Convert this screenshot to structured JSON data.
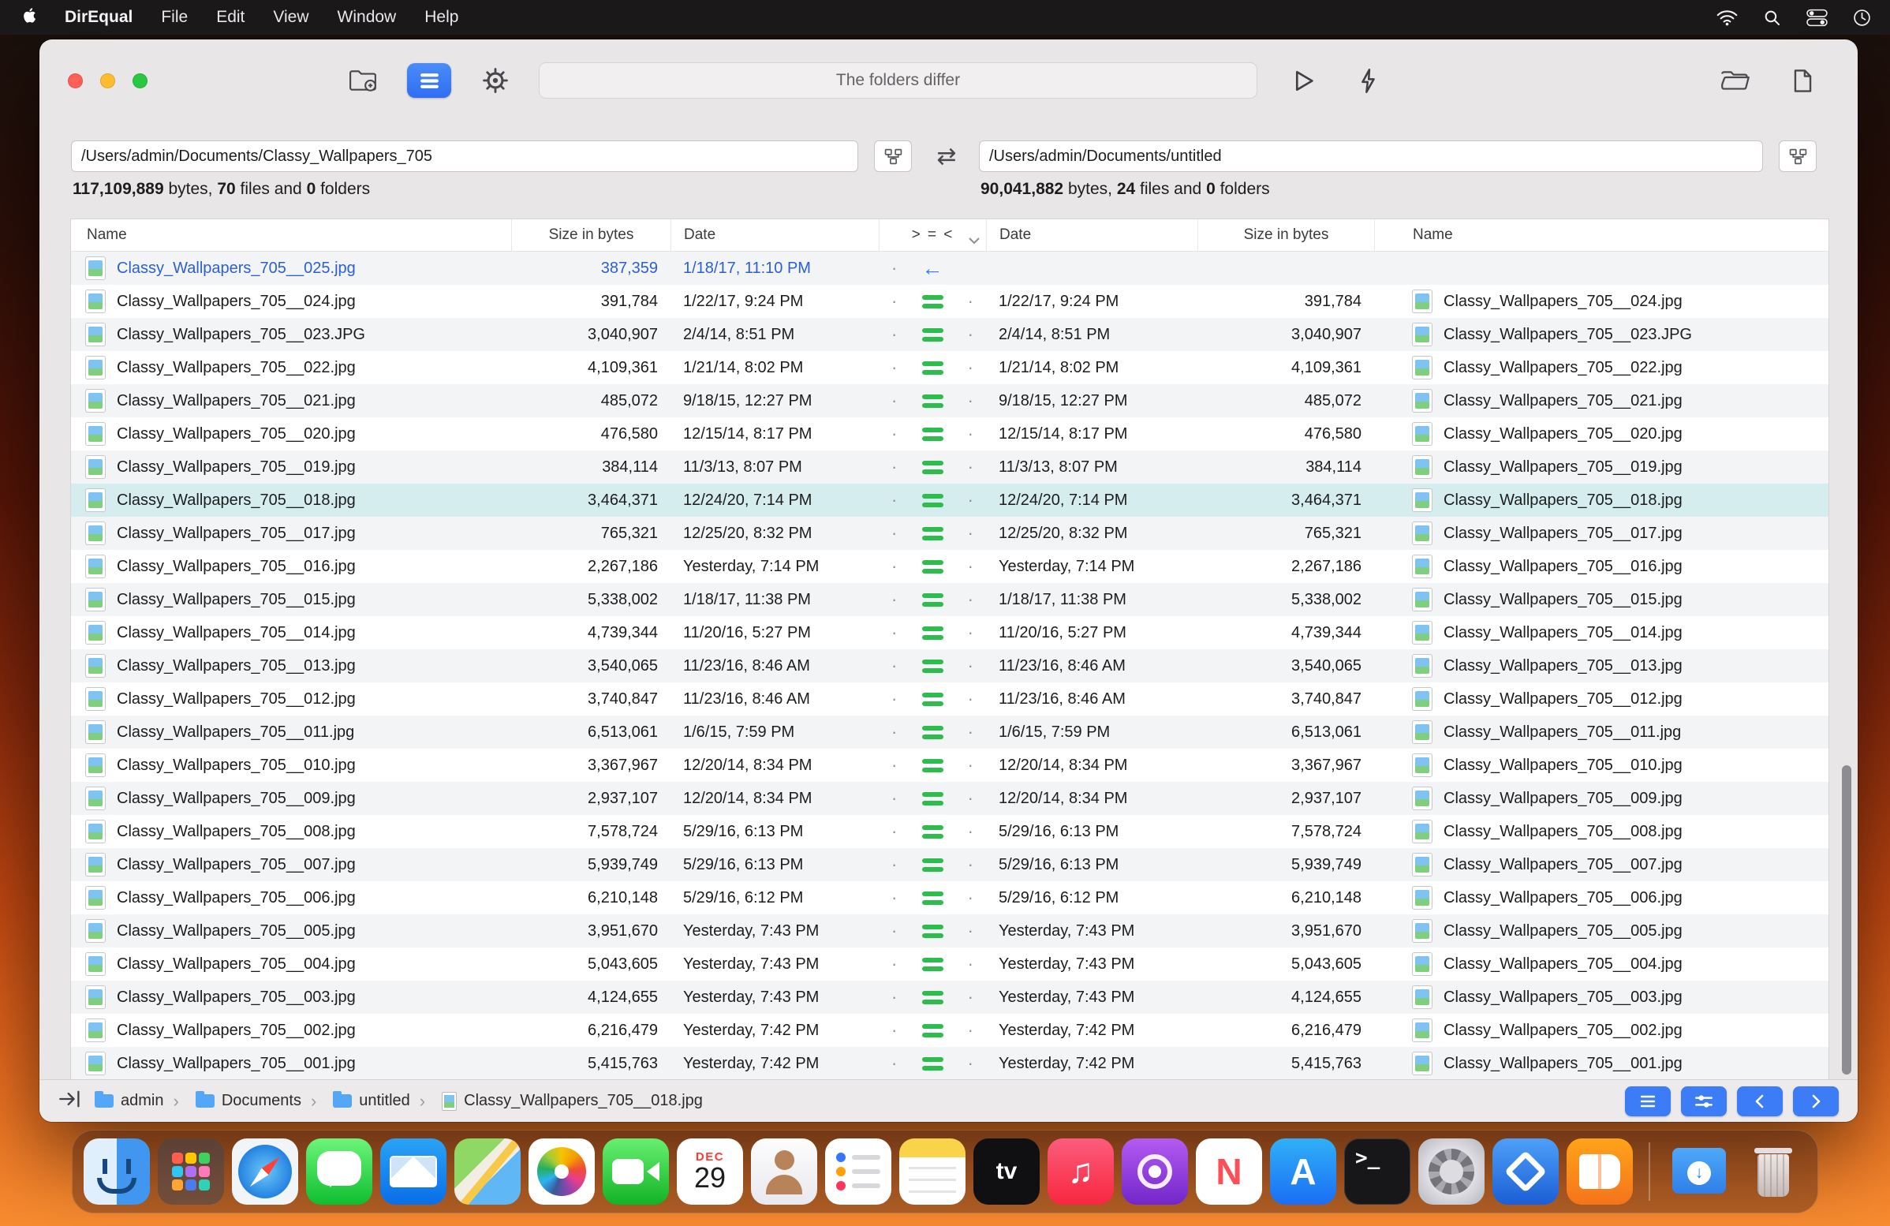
{
  "menu_bar": {
    "app_name": "DirEqual",
    "menus": [
      "File",
      "Edit",
      "View",
      "Window",
      "Help"
    ]
  },
  "toolbar": {
    "status_text": "The folders differ"
  },
  "panes": {
    "left": {
      "path": "/Users/admin/Documents/Classy_Wallpapers_705",
      "bytes": "117,109,889",
      "files": "70",
      "folders": "0"
    },
    "right": {
      "path": "/Users/admin/Documents/untitled",
      "bytes": "90,041,882",
      "files": "24",
      "folders": "0"
    },
    "bytes_word": " bytes, ",
    "files_word": " files and ",
    "folders_word": " folders"
  },
  "icons": {
    "swap": "⇄",
    "dot": "·",
    "left_arrow": "←"
  },
  "table": {
    "headers": {
      "name_left": "Name",
      "size_left": "Size in bytes",
      "date_left": "Date",
      "compare": "> = <",
      "date_right": "Date",
      "size_right": "Size in bytes",
      "name_right": "Name"
    },
    "rows": [
      {
        "name": "Classy_Wallpapers_705__025.jpg",
        "size": "387,359",
        "date": "1/18/17, 11:10 PM",
        "status": "left_only",
        "selected": false
      },
      {
        "name": "Classy_Wallpapers_705__024.jpg",
        "size": "391,784",
        "date": "1/22/17, 9:24 PM",
        "status": "equal",
        "selected": false
      },
      {
        "name": "Classy_Wallpapers_705__023.JPG",
        "size": "3,040,907",
        "date": "2/4/14, 8:51 PM",
        "status": "equal",
        "selected": false
      },
      {
        "name": "Classy_Wallpapers_705__022.jpg",
        "size": "4,109,361",
        "date": "1/21/14, 8:02 PM",
        "status": "equal",
        "selected": false
      },
      {
        "name": "Classy_Wallpapers_705__021.jpg",
        "size": "485,072",
        "date": "9/18/15, 12:27 PM",
        "status": "equal",
        "selected": false
      },
      {
        "name": "Classy_Wallpapers_705__020.jpg",
        "size": "476,580",
        "date": "12/15/14, 8:17 PM",
        "status": "equal",
        "selected": false
      },
      {
        "name": "Classy_Wallpapers_705__019.jpg",
        "size": "384,114",
        "date": "11/3/13, 8:07 PM",
        "status": "equal",
        "selected": false
      },
      {
        "name": "Classy_Wallpapers_705__018.jpg",
        "size": "3,464,371",
        "date": "12/24/20, 7:14 PM",
        "status": "equal",
        "selected": true
      },
      {
        "name": "Classy_Wallpapers_705__017.jpg",
        "size": "765,321",
        "date": "12/25/20, 8:32 PM",
        "status": "equal",
        "selected": false
      },
      {
        "name": "Classy_Wallpapers_705__016.jpg",
        "size": "2,267,186",
        "date": "Yesterday, 7:14 PM",
        "status": "equal",
        "selected": false
      },
      {
        "name": "Classy_Wallpapers_705__015.jpg",
        "size": "5,338,002",
        "date": "1/18/17, 11:38 PM",
        "status": "equal",
        "selected": false
      },
      {
        "name": "Classy_Wallpapers_705__014.jpg",
        "size": "4,739,344",
        "date": "11/20/16, 5:27 PM",
        "status": "equal",
        "selected": false
      },
      {
        "name": "Classy_Wallpapers_705__013.jpg",
        "size": "3,540,065",
        "date": "11/23/16, 8:46 AM",
        "status": "equal",
        "selected": false
      },
      {
        "name": "Classy_Wallpapers_705__012.jpg",
        "size": "3,740,847",
        "date": "11/23/16, 8:46 AM",
        "status": "equal",
        "selected": false
      },
      {
        "name": "Classy_Wallpapers_705__011.jpg",
        "size": "6,513,061",
        "date": "1/6/15, 7:59 PM",
        "status": "equal",
        "selected": false
      },
      {
        "name": "Classy_Wallpapers_705__010.jpg",
        "size": "3,367,967",
        "date": "12/20/14, 8:34 PM",
        "status": "equal",
        "selected": false
      },
      {
        "name": "Classy_Wallpapers_705__009.jpg",
        "size": "2,937,107",
        "date": "12/20/14, 8:34 PM",
        "status": "equal",
        "selected": false
      },
      {
        "name": "Classy_Wallpapers_705__008.jpg",
        "size": "7,578,724",
        "date": "5/29/16, 6:13 PM",
        "status": "equal",
        "selected": false
      },
      {
        "name": "Classy_Wallpapers_705__007.jpg",
        "size": "5,939,749",
        "date": "5/29/16, 6:13 PM",
        "status": "equal",
        "selected": false
      },
      {
        "name": "Classy_Wallpapers_705__006.jpg",
        "size": "6,210,148",
        "date": "5/29/16, 6:12 PM",
        "status": "equal",
        "selected": false
      },
      {
        "name": "Classy_Wallpapers_705__005.jpg",
        "size": "3,951,670",
        "date": "Yesterday, 7:43 PM",
        "status": "equal",
        "selected": false
      },
      {
        "name": "Classy_Wallpapers_705__004.jpg",
        "size": "5,043,605",
        "date": "Yesterday, 7:43 PM",
        "status": "equal",
        "selected": false
      },
      {
        "name": "Classy_Wallpapers_705__003.jpg",
        "size": "4,124,655",
        "date": "Yesterday, 7:43 PM",
        "status": "equal",
        "selected": false
      },
      {
        "name": "Classy_Wallpapers_705__002.jpg",
        "size": "6,216,479",
        "date": "Yesterday, 7:42 PM",
        "status": "equal",
        "selected": false
      },
      {
        "name": "Classy_Wallpapers_705__001.jpg",
        "size": "5,415,763",
        "date": "Yesterday, 7:42 PM",
        "status": "equal",
        "selected": false
      }
    ]
  },
  "status_bar": {
    "crumbs": [
      {
        "label": "admin",
        "type": "folder"
      },
      {
        "label": "Documents",
        "type": "folder"
      },
      {
        "label": "untitled",
        "type": "folder"
      },
      {
        "label": "Classy_Wallpapers_705__018.jpg",
        "type": "file"
      }
    ]
  },
  "dock": {
    "calendar": {
      "month": "DEC",
      "day": "29"
    },
    "apps": [
      "finder",
      "launchpad",
      "safari",
      "messages",
      "mail",
      "maps",
      "photos",
      "facetime",
      "calendar",
      "contacts",
      "reminders",
      "notes",
      "tv",
      "music",
      "podcasts",
      "news",
      "appstore",
      "terminal",
      "sysprefs",
      "direqual",
      "books"
    ],
    "extras": [
      "downloads",
      "trash"
    ]
  }
}
